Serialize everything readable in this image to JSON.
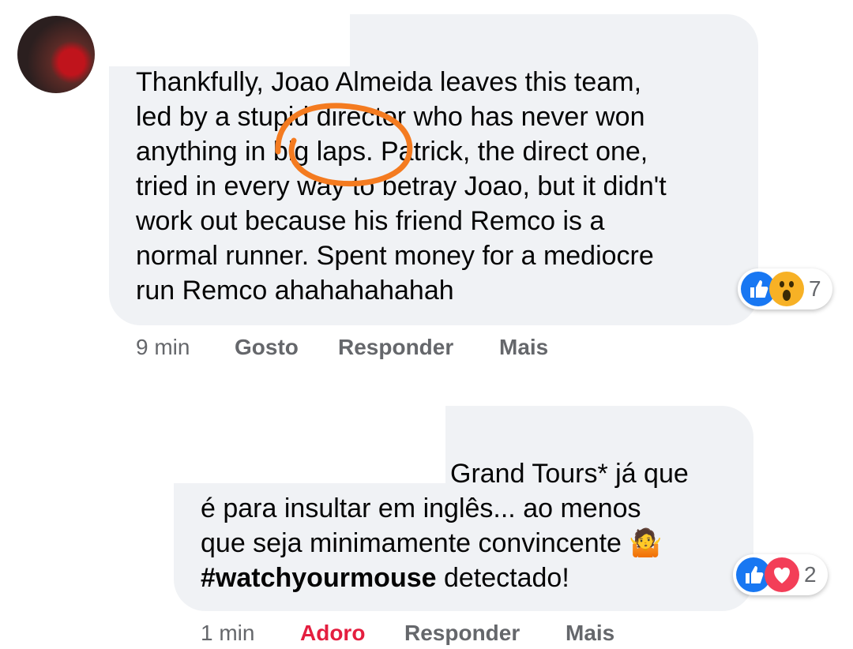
{
  "comments": [
    {
      "lines": [
        "Thankfully, Joao Almeida leaves this team,",
        "led by a stupid director who has never won",
        "anything in big laps. Patrick, the direct one,",
        "tried in every way to betray Joao, but it didn't",
        "work out because his friend Remco is a",
        "normal runner. Spent money for a mediocre",
        "run Remco ahahahahahah"
      ],
      "reactions": {
        "icons": [
          "like-icon",
          "wow-icon"
        ],
        "count": "7"
      },
      "meta": {
        "time": "9 min",
        "like": "Gosto",
        "reply": "Responder",
        "more": "Mais"
      }
    },
    {
      "lines": [
        "Grand Tours* já que",
        "é para insultar em inglês... ao menos",
        "que seja minimamente convincente"
      ],
      "emoji": "🤷",
      "hashtag": "#watchyourmouse",
      "tail": " detectado!",
      "reactions": {
        "icons": [
          "like-icon",
          "love-icon"
        ],
        "count": "2"
      },
      "meta": {
        "time": "1 min",
        "like": "Adoro",
        "reply": "Responder",
        "more": "Mais"
      }
    }
  ],
  "colors": {
    "bubble": "#f0f2f5",
    "meta": "#65676b",
    "love": "#e41e3f",
    "like": "#1877f2",
    "annotation": "#f47b20"
  }
}
